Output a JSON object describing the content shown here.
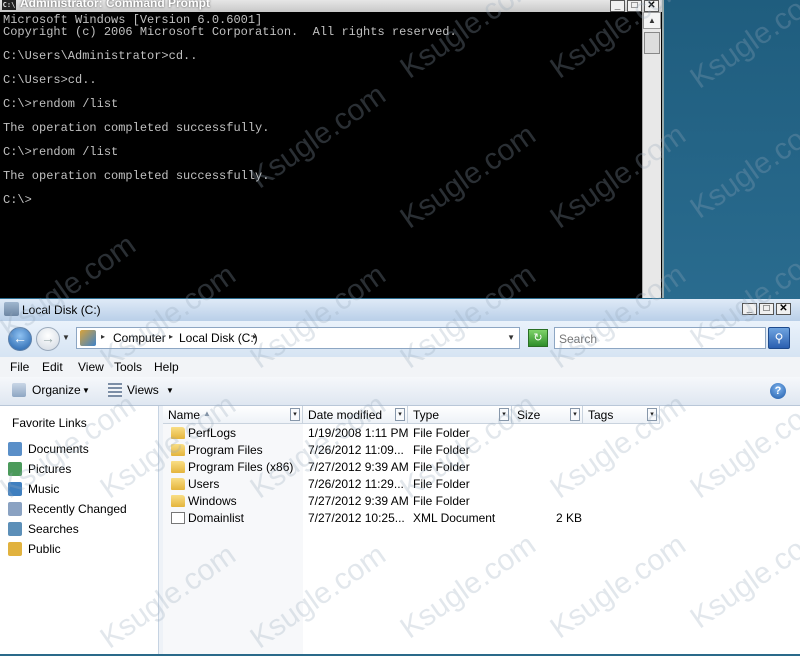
{
  "cmd": {
    "title": "Administrator: Command Prompt",
    "icon": "cmd-icon",
    "icon_text": "C:\\",
    "lines": [
      "Microsoft Windows [Version 6.0.6001]",
      "Copyright (c) 2006 Microsoft Corporation.  All rights reserved.",
      "",
      "C:\\Users\\Administrator>cd..",
      "",
      "C:\\Users>cd..",
      "",
      "C:\\>rendom /list",
      "",
      "The operation completed successfully.",
      "",
      "C:\\>rendom /list",
      "",
      "The operation completed successfully.",
      "",
      "C:\\>"
    ],
    "buttons": {
      "minimize": "_",
      "maximize": "□",
      "close": "✕"
    },
    "scroll": {
      "up": "▲"
    }
  },
  "explorer": {
    "title": "Local Disk (C:)",
    "buttons": {
      "minimize": "_",
      "maximize": "□",
      "close": "✕"
    },
    "nav": {
      "back": "←",
      "forward": "→",
      "dropdown": "▼"
    },
    "breadcrumb": [
      "Computer",
      "Local Disk (C:)"
    ],
    "breadcrumb_sep": "▸",
    "address_dropdown": "▼",
    "refresh": "↻",
    "search": {
      "placeholder": "Search",
      "button": "⚲"
    },
    "menu": [
      "File",
      "Edit",
      "View",
      "Tools",
      "Help"
    ],
    "toolbar": {
      "organize": "Organize",
      "views": "Views",
      "dropdown": "▼",
      "help": "?"
    },
    "favorites_header": "Favorite Links",
    "favorites": [
      {
        "label": "Documents",
        "icon": "documents-icon",
        "color": "#5a8fc8"
      },
      {
        "label": "Pictures",
        "icon": "pictures-icon",
        "color": "#4b9a5b"
      },
      {
        "label": "Music",
        "icon": "music-icon",
        "color": "#3f7fbf"
      },
      {
        "label": "Recently Changed",
        "icon": "recently-changed-icon",
        "color": "#8aa2c2"
      },
      {
        "label": "Searches",
        "icon": "searches-icon",
        "color": "#5c8fb8"
      },
      {
        "label": "Public",
        "icon": "public-folder-icon",
        "color": "#e1b23e"
      }
    ],
    "columns": [
      "Name",
      "Date modified",
      "Type",
      "Size",
      "Tags"
    ],
    "column_dropdown": "▾",
    "sort_indicator": "▲",
    "files": [
      {
        "name": "PerfLogs",
        "date": "1/19/2008 1:11 PM",
        "type": "File Folder",
        "size": "",
        "kind": "folder"
      },
      {
        "name": "Program Files",
        "date": "7/26/2012 11:09...",
        "type": "File Folder",
        "size": "",
        "kind": "folder"
      },
      {
        "name": "Program Files (x86)",
        "date": "7/27/2012 9:39 AM",
        "type": "File Folder",
        "size": "",
        "kind": "folder"
      },
      {
        "name": "Users",
        "date": "7/26/2012 11:29...",
        "type": "File Folder",
        "size": "",
        "kind": "folder"
      },
      {
        "name": "Windows",
        "date": "7/27/2012 9:39 AM",
        "type": "File Folder",
        "size": "",
        "kind": "folder"
      },
      {
        "name": "Domainlist",
        "date": "7/27/2012 10:25...",
        "type": "XML Document",
        "size": "2 KB",
        "kind": "xml"
      }
    ]
  },
  "watermark": "Ksugle.com"
}
